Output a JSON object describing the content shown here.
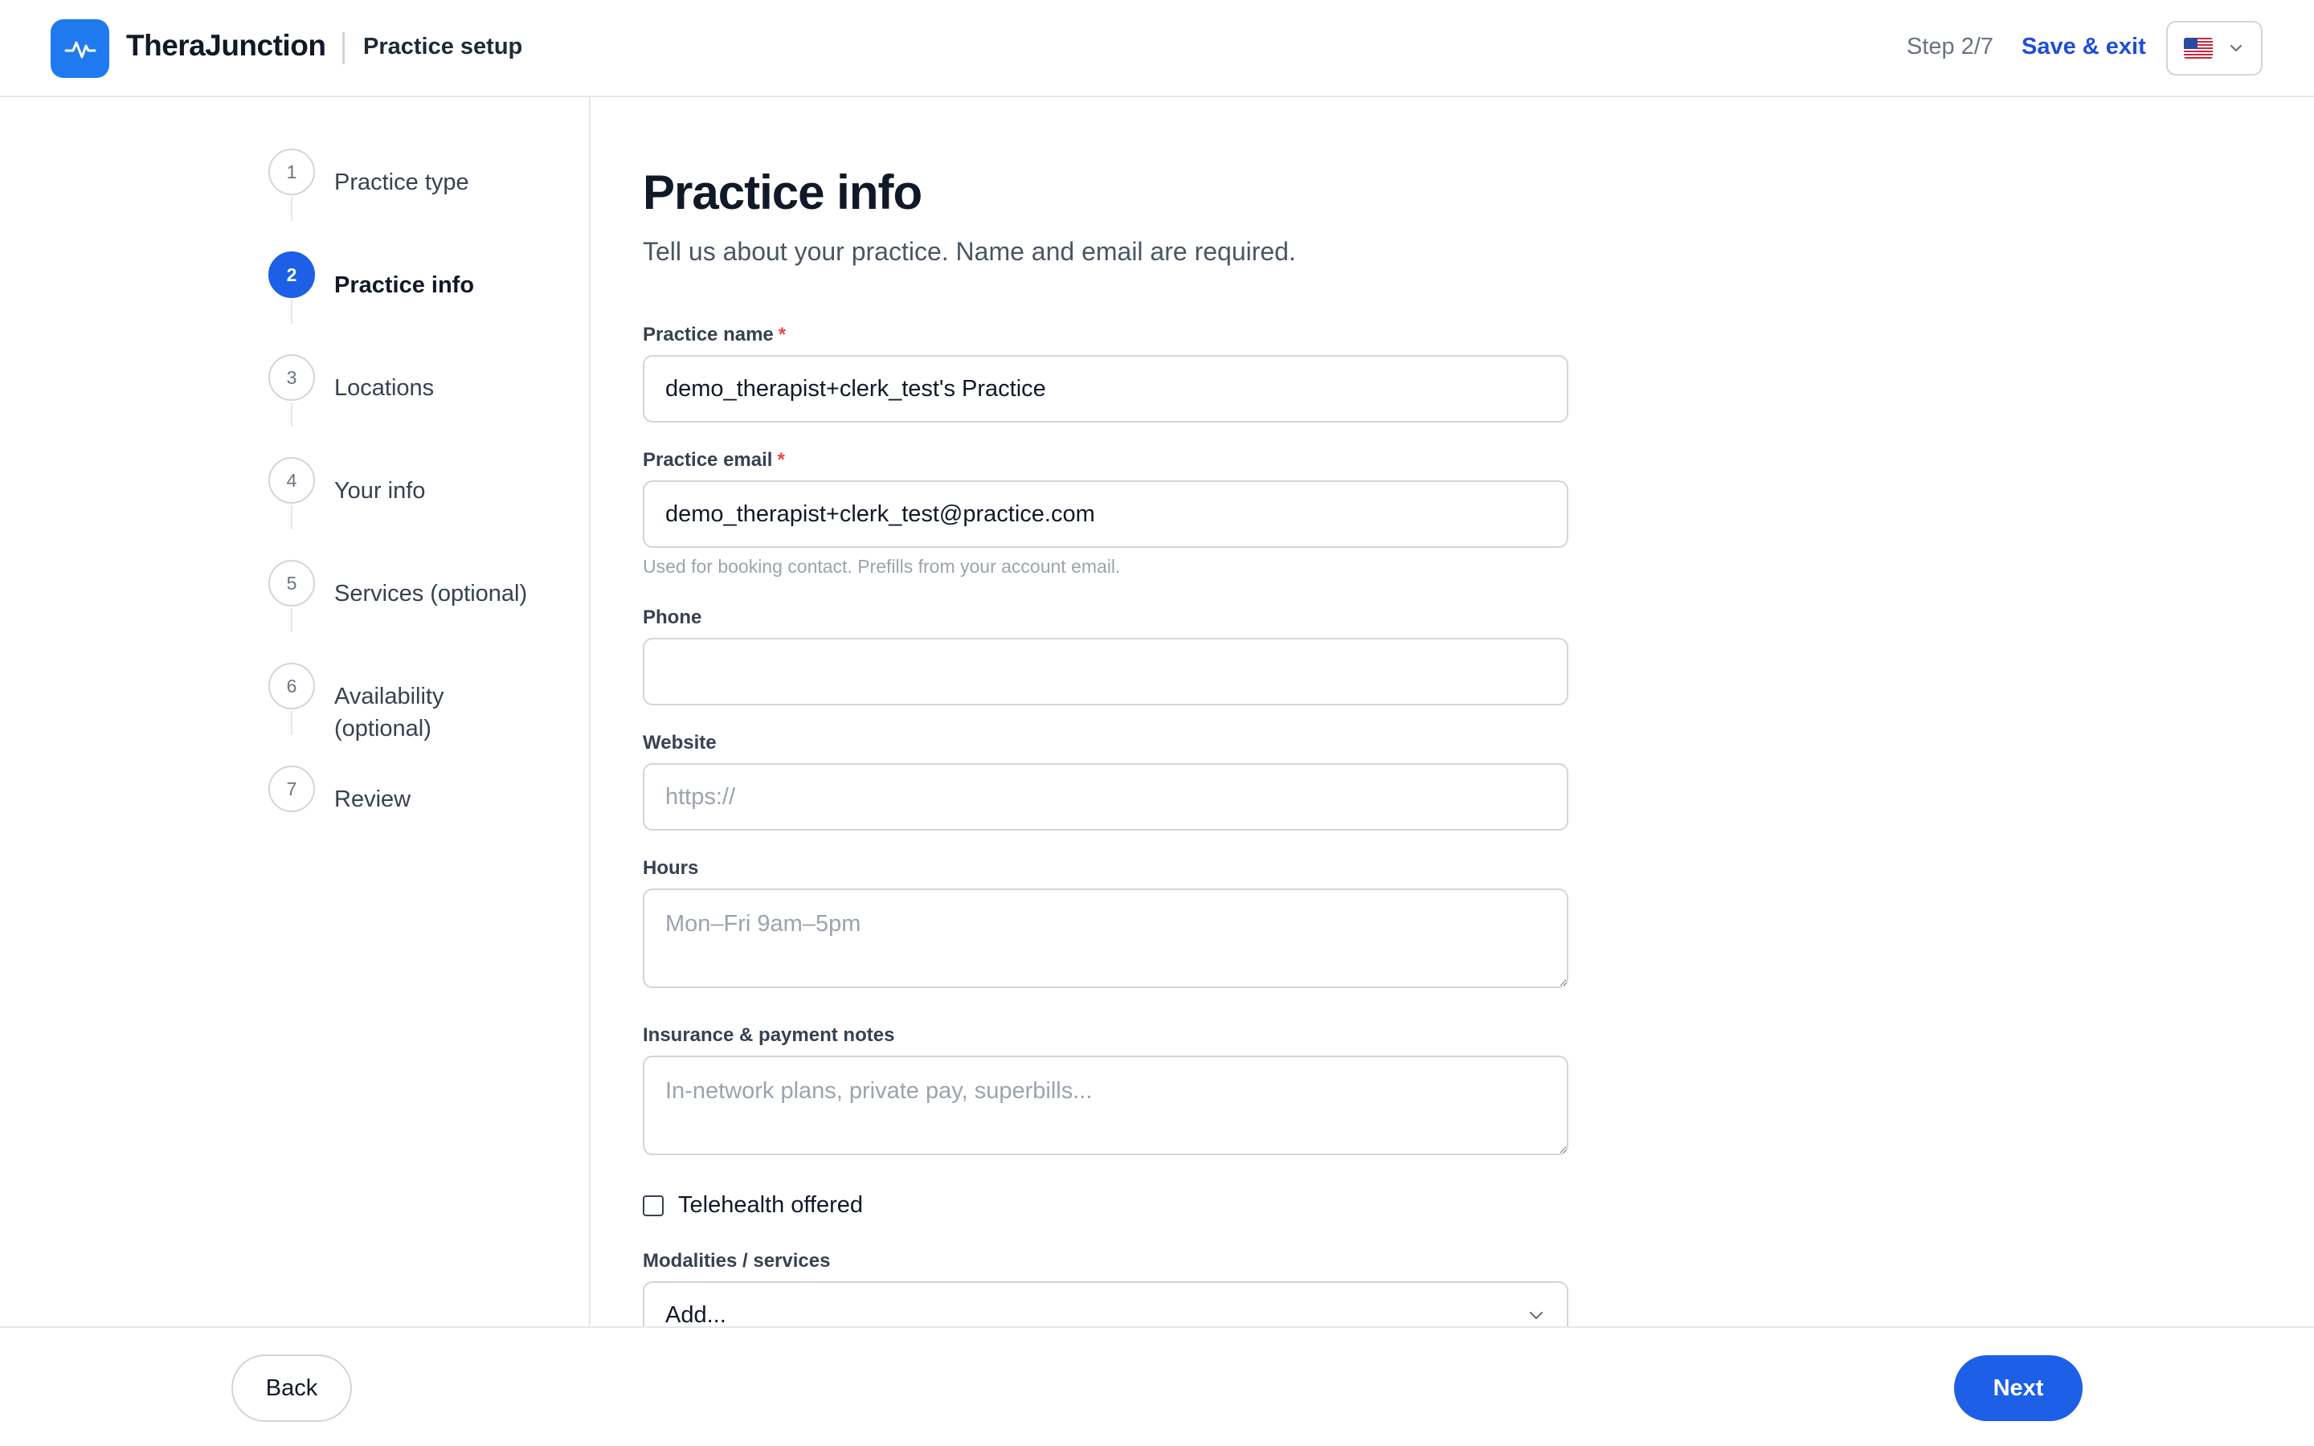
{
  "header": {
    "brand": "TheraJunction",
    "subtitle": "Practice setup",
    "step_indicator": "Step 2/7",
    "save_exit_label": "Save & exit",
    "language_flag": "us-flag"
  },
  "sidebar": {
    "steps": [
      {
        "number": "1",
        "label": "Practice type",
        "state": "upcoming"
      },
      {
        "number": "2",
        "label": "Practice info",
        "state": "active"
      },
      {
        "number": "3",
        "label": "Locations",
        "state": "upcoming"
      },
      {
        "number": "4",
        "label": "Your info",
        "state": "upcoming"
      },
      {
        "number": "5",
        "label": "Services (optional)",
        "state": "upcoming"
      },
      {
        "number": "6",
        "label": "Availability (optional)",
        "state": "upcoming"
      },
      {
        "number": "7",
        "label": "Review",
        "state": "upcoming"
      }
    ]
  },
  "form": {
    "title": "Practice info",
    "description": "Tell us about your practice. Name and email are required.",
    "required_mark": "*",
    "practice_name": {
      "label": "Practice name",
      "value": "demo_therapist+clerk_test's Practice",
      "placeholder": ""
    },
    "practice_email": {
      "label": "Practice email",
      "value": "demo_therapist+clerk_test@practice.com",
      "placeholder": "",
      "help": "Used for booking contact. Prefills from your account email."
    },
    "phone": {
      "label": "Phone",
      "value": "",
      "placeholder": ""
    },
    "website": {
      "label": "Website",
      "value": "",
      "placeholder": "https://"
    },
    "hours": {
      "label": "Hours",
      "value": "",
      "placeholder": "Mon–Fri 9am–5pm"
    },
    "insurance": {
      "label": "Insurance & payment notes",
      "value": "",
      "placeholder": "In-network plans, private pay, superbills..."
    },
    "telehealth": {
      "label": "Telehealth offered",
      "checked": false
    },
    "modalities": {
      "label": "Modalities / services",
      "selected": "Add..."
    }
  },
  "footer": {
    "back_label": "Back",
    "next_label": "Next"
  },
  "colors": {
    "accent": "#1d5fe6",
    "brand_logo": "#1f7aef",
    "link": "#1d4ed8",
    "required": "#ef4444",
    "border": "#d1d5db"
  }
}
